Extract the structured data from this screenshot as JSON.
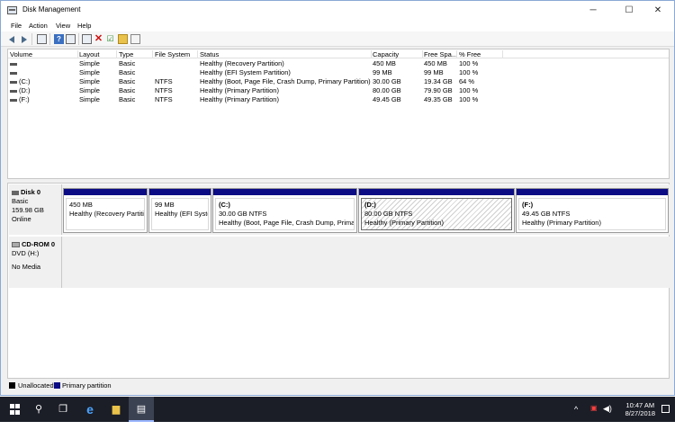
{
  "window": {
    "title": "Disk Management",
    "min_glyph": "─",
    "max_glyph": "☐",
    "close_glyph": "✕"
  },
  "menu": [
    "File",
    "Action",
    "View",
    "Help"
  ],
  "toolbar": {
    "icons": [
      "back-arrow-icon",
      "forward-arrow-icon",
      "disk-list-icon",
      "help-icon",
      "properties-icon",
      "connect-icon",
      "delete-icon",
      "check-icon",
      "folder-icon",
      "document-icon"
    ]
  },
  "volume_table": {
    "columns": [
      "Volume",
      "Layout",
      "Type",
      "File System",
      "Status",
      "Capacity",
      "Free Spa...",
      "% Free"
    ],
    "rows": [
      {
        "volume": "",
        "layout": "Simple",
        "type": "Basic",
        "fs": "",
        "status": "Healthy (Recovery Partition)",
        "capacity": "450 MB",
        "free": "450 MB",
        "pct": "100 %"
      },
      {
        "volume": "",
        "layout": "Simple",
        "type": "Basic",
        "fs": "",
        "status": "Healthy (EFI System Partition)",
        "capacity": "99 MB",
        "free": "99 MB",
        "pct": "100 %"
      },
      {
        "volume": "(C:)",
        "layout": "Simple",
        "type": "Basic",
        "fs": "NTFS",
        "status": "Healthy (Boot, Page File, Crash Dump, Primary Partition)",
        "capacity": "30.00 GB",
        "free": "19.34 GB",
        "pct": "64 %"
      },
      {
        "volume": "(D:)",
        "layout": "Simple",
        "type": "Basic",
        "fs": "NTFS",
        "status": "Healthy (Primary Partition)",
        "capacity": "80.00 GB",
        "free": "79.90 GB",
        "pct": "100 %"
      },
      {
        "volume": "(F:)",
        "layout": "Simple",
        "type": "Basic",
        "fs": "NTFS",
        "status": "Healthy (Primary Partition)",
        "capacity": "49.45 GB",
        "free": "49.35 GB",
        "pct": "100 %"
      }
    ]
  },
  "disks": [
    {
      "name": "Disk 0",
      "type": "Basic",
      "size": "159.98 GB",
      "state": "Online",
      "partitions": [
        {
          "label": "",
          "size": "450 MB",
          "status": "Healthy (Recovery Partition)"
        },
        {
          "label": "",
          "size": "99 MB",
          "status": "Healthy (EFI System"
        },
        {
          "label": "(C:)",
          "size": "30.00 GB NTFS",
          "status": "Healthy (Boot, Page File, Crash Dump, Primary Pa"
        },
        {
          "label": "(D:)",
          "size": "80.00 GB NTFS",
          "status": "Healthy (Primary Partition)"
        },
        {
          "label": "(F:)",
          "size": "49.45 GB NTFS",
          "status": "Healthy (Primary Partition)"
        }
      ]
    },
    {
      "name": "CD-ROM 0",
      "type": "DVD (H:)",
      "state": "No Media"
    }
  ],
  "legend": [
    {
      "label": "Unallocated",
      "color": "#000000"
    },
    {
      "label": "Primary partition",
      "color": "#0c0c84"
    }
  ],
  "taskbar": {
    "icons": [
      "windows-start-icon",
      "search-icon",
      "task-view-icon",
      "edge-icon",
      "file-explorer-icon",
      "disk-management-icon"
    ],
    "time": "10:47 AM",
    "date": "8/27/2018"
  }
}
